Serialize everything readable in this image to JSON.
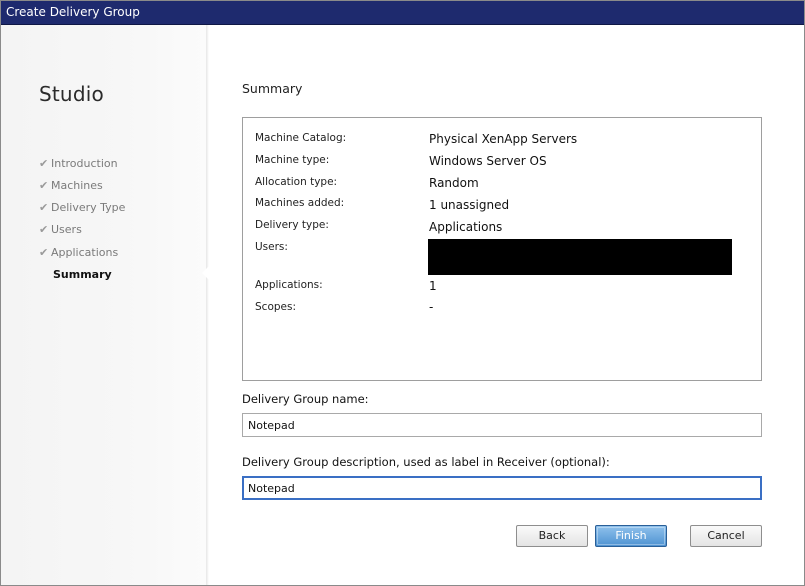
{
  "window": {
    "title": "Create Delivery Group"
  },
  "sidebar": {
    "title": "Studio",
    "items": [
      {
        "label": "Introduction",
        "done": true
      },
      {
        "label": "Machines",
        "done": true
      },
      {
        "label": "Delivery Type",
        "done": true
      },
      {
        "label": "Users",
        "done": true
      },
      {
        "label": "Applications",
        "done": true
      },
      {
        "label": "Summary",
        "active": true
      }
    ]
  },
  "main": {
    "section_title": "Summary",
    "summary": [
      {
        "label": "Machine Catalog:",
        "value": "Physical XenApp Servers"
      },
      {
        "label": "Machine type:",
        "value": "Windows Server OS"
      },
      {
        "label": "Allocation type:",
        "value": "Random"
      },
      {
        "label": "Machines added:",
        "value": "1 unassigned"
      },
      {
        "label": "Delivery type:",
        "value": "Applications"
      },
      {
        "label": "Users:",
        "value": ""
      },
      {
        "label": "Applications:",
        "value": "1"
      },
      {
        "label": "Scopes:",
        "value": "-"
      }
    ],
    "name_label": "Delivery Group name:",
    "name_value": "Notepad",
    "description_label": "Delivery Group description, used as label in Receiver (optional):",
    "description_value": "Notepad"
  },
  "buttons": {
    "back": "Back",
    "finish": "Finish",
    "cancel": "Cancel"
  },
  "colors": {
    "titlebar": "#1e2a6e",
    "accent": "#4f93d2",
    "focus": "#3a6fc4"
  },
  "icons": {
    "nav_done": "checkmark-icon"
  }
}
